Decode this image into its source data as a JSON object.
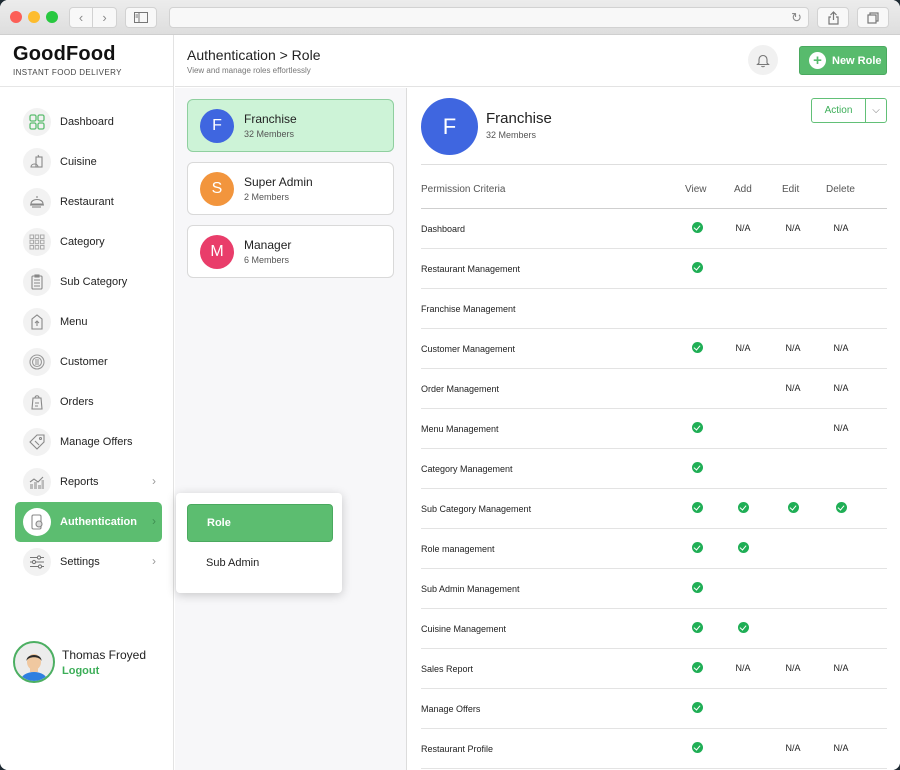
{
  "browser": {
    "back_icon": "‹",
    "forward_icon": "›",
    "reload_icon": "↻"
  },
  "brand": {
    "name": "GoodFood",
    "tagline": "INSTANT FOOD DELIVERY"
  },
  "header": {
    "title": "Authentication > Role",
    "subtitle": "View and manage roles effortlessly",
    "new_role_label": "New Role",
    "plus_icon": "+"
  },
  "sidebar": {
    "items": [
      {
        "label": "Dashboard",
        "icon": "dashboard-icon",
        "active": false,
        "has_submenu": false
      },
      {
        "label": "Cuisine",
        "icon": "cuisine-icon",
        "active": false,
        "has_submenu": false
      },
      {
        "label": "Restaurant",
        "icon": "restaurant-icon",
        "active": false,
        "has_submenu": false
      },
      {
        "label": "Category",
        "icon": "category-icon",
        "active": false,
        "has_submenu": false
      },
      {
        "label": "Sub Category",
        "icon": "sub-category-icon",
        "active": false,
        "has_submenu": false
      },
      {
        "label": "Menu",
        "icon": "menu-icon",
        "active": false,
        "has_submenu": false
      },
      {
        "label": "Customer",
        "icon": "customer-icon",
        "active": false,
        "has_submenu": false
      },
      {
        "label": "Orders",
        "icon": "orders-icon",
        "active": false,
        "has_submenu": false
      },
      {
        "label": "Manage Offers",
        "icon": "offers-icon",
        "active": false,
        "has_submenu": false
      },
      {
        "label": "Reports",
        "icon": "reports-icon",
        "active": false,
        "has_submenu": true
      },
      {
        "label": "Authentication",
        "icon": "authentication-icon",
        "active": true,
        "has_submenu": true
      },
      {
        "label": "Settings",
        "icon": "settings-icon",
        "active": false,
        "has_submenu": true
      }
    ],
    "chevron": "›"
  },
  "submenu": {
    "items": [
      {
        "label": "Role",
        "active": true
      },
      {
        "label": "Sub Admin",
        "active": false
      }
    ]
  },
  "profile": {
    "name": "Thomas Froyed",
    "logout_label": "Logout"
  },
  "roles": [
    {
      "initial": "F",
      "name": "Franchise",
      "members": "32 Members",
      "color": "#3f66e0",
      "selected": true
    },
    {
      "initial": "S",
      "name": "Super Admin",
      "members": "2 Members",
      "color": "#f2953d",
      "selected": false
    },
    {
      "initial": "M",
      "name": "Manager",
      "members": "6 Members",
      "color": "#e93d6a",
      "selected": false
    }
  ],
  "detail": {
    "initial": "F",
    "name": "Franchise",
    "members": "32 Members",
    "action_label": "Action",
    "caret_icon": "⌵",
    "columns": [
      "Permission Criteria",
      "View",
      "Add",
      "Edit",
      "Delete"
    ],
    "rows": [
      {
        "criteria": "Dashboard",
        "view": "check",
        "add": "N/A",
        "edit": "N/A",
        "delete": "N/A"
      },
      {
        "criteria": "Restaurant Management",
        "view": "check",
        "add": "",
        "edit": "",
        "delete": ""
      },
      {
        "criteria": "Franchise Management",
        "view": "",
        "add": "",
        "edit": "",
        "delete": ""
      },
      {
        "criteria": "Customer Management",
        "view": "check",
        "add": "N/A",
        "edit": "N/A",
        "delete": "N/A"
      },
      {
        "criteria": "Order Management",
        "view": "",
        "add": "",
        "edit": "N/A",
        "delete": "N/A"
      },
      {
        "criteria": "Menu Management",
        "view": "check",
        "add": "",
        "edit": "",
        "delete": "N/A"
      },
      {
        "criteria": "Category Management",
        "view": "check",
        "add": "",
        "edit": "",
        "delete": ""
      },
      {
        "criteria": "Sub Category Management",
        "view": "check",
        "add": "check",
        "edit": "check",
        "delete": "check"
      },
      {
        "criteria": "Role management",
        "view": "check",
        "add": "check",
        "edit": "",
        "delete": ""
      },
      {
        "criteria": "Sub Admin Management",
        "view": "check",
        "add": "",
        "edit": "",
        "delete": ""
      },
      {
        "criteria": "Cuisine Management",
        "view": "check",
        "add": "check",
        "edit": "",
        "delete": ""
      },
      {
        "criteria": "Sales Report",
        "view": "check",
        "add": "N/A",
        "edit": "N/A",
        "delete": "N/A"
      },
      {
        "criteria": "Manage Offers",
        "view": "check",
        "add": "",
        "edit": "",
        "delete": ""
      },
      {
        "criteria": "Restaurant Profile",
        "view": "check",
        "add": "",
        "edit": "N/A",
        "delete": "N/A"
      }
    ]
  },
  "colors": {
    "accent": "#5cbd70",
    "check": "#1fae55",
    "selected_role_bg": "#cdf3d7"
  }
}
